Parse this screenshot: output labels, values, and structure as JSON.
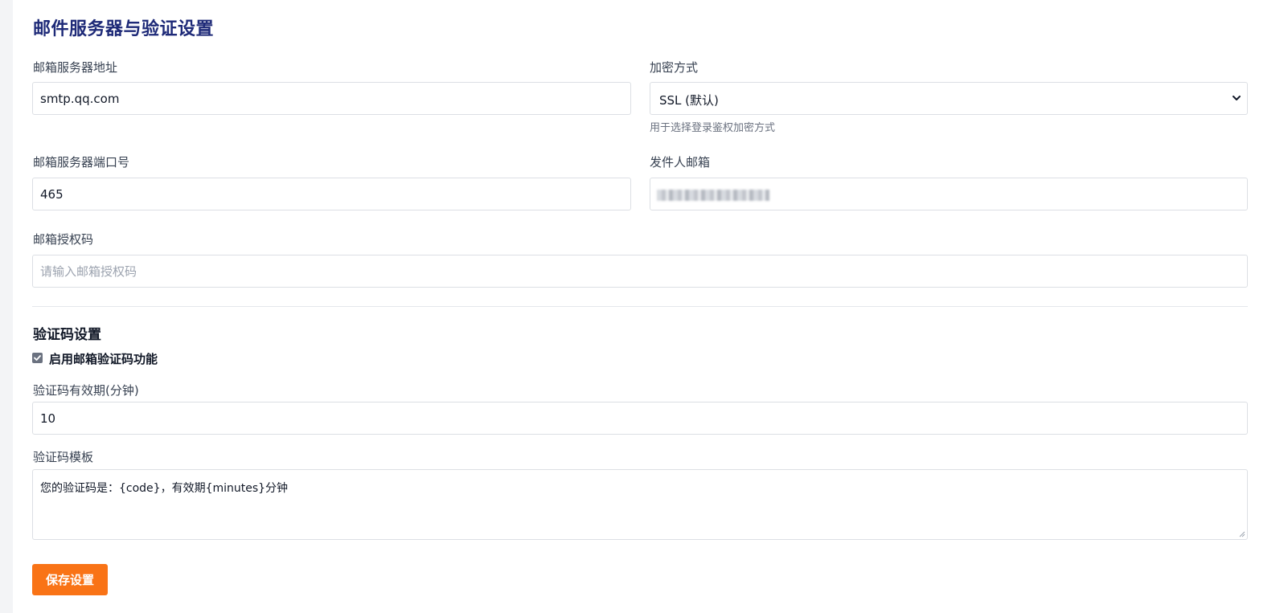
{
  "page": {
    "title": "邮件服务器与验证设置"
  },
  "fields": {
    "smtp_host": {
      "label": "邮箱服务器地址",
      "value": "smtp.qq.com"
    },
    "encryption": {
      "label": "加密方式",
      "selected": "SSL (默认)",
      "hint": "用于选择登录鉴权加密方式"
    },
    "smtp_port": {
      "label": "邮箱服务器端口号",
      "value": "465"
    },
    "sender": {
      "label": "发件人邮箱"
    },
    "auth_code": {
      "label": "邮箱授权码",
      "placeholder": "请输入邮箱授权码"
    }
  },
  "verification": {
    "section_title": "验证码设置",
    "enable_label": "启用邮箱验证码功能",
    "enabled": true,
    "validity": {
      "label": "验证码有效期(分钟)",
      "value": "10"
    },
    "template": {
      "label": "验证码模板",
      "value": "您的验证码是：{code}，有效期{minutes}分钟"
    }
  },
  "actions": {
    "save_label": "保存设置"
  },
  "colors": {
    "title": "#1e2a78",
    "save_button": "#f97316",
    "checkbox": "#6b7280"
  }
}
